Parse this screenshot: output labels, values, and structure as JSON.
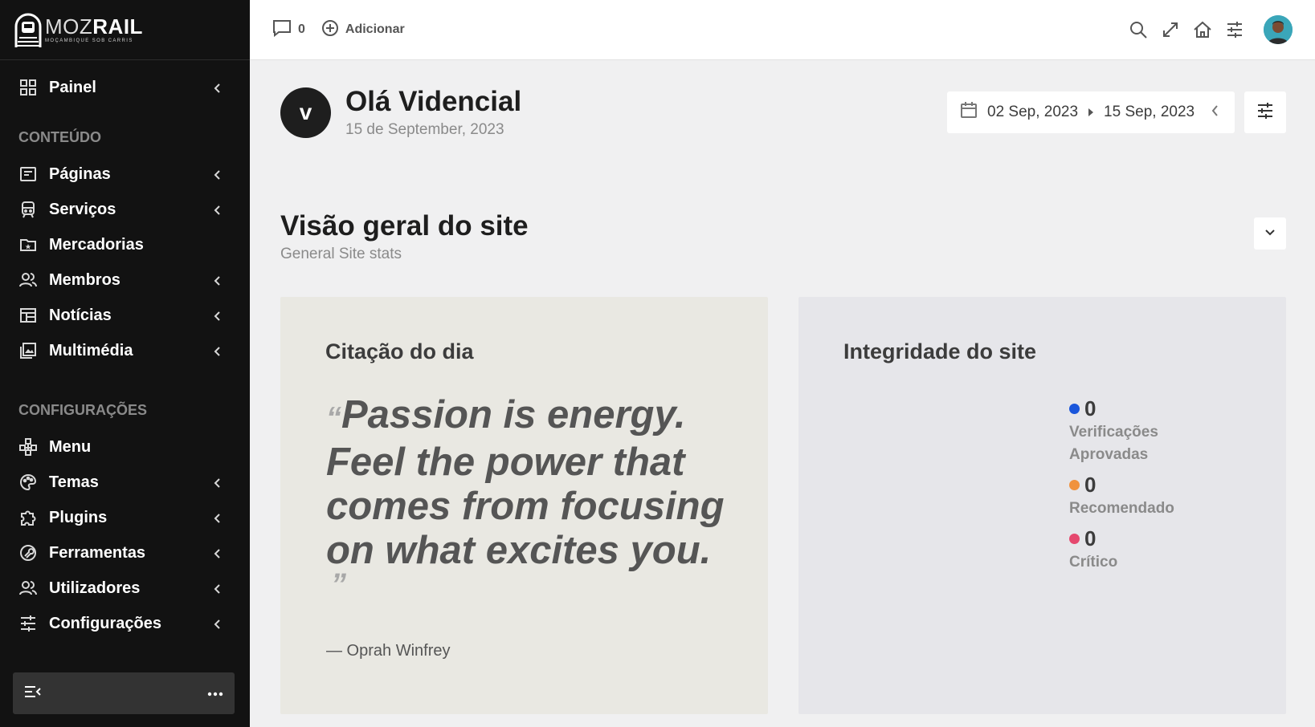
{
  "brand": {
    "word_thin": "MOZ",
    "word_bold": "RAIL",
    "tagline": "MOÇAMBIQUE SOB CARRIS"
  },
  "sidebar": {
    "top_items": [
      {
        "label": "Painel",
        "icon": "grid-icon",
        "has_submenu": true
      }
    ],
    "section_content": "CONTEÚDO",
    "content_items": [
      {
        "label": "Páginas",
        "icon": "page-icon",
        "has_submenu": true
      },
      {
        "label": "Serviços",
        "icon": "train-icon",
        "has_submenu": true
      },
      {
        "label": "Mercadorias",
        "icon": "folder-star-icon",
        "has_submenu": false
      },
      {
        "label": "Membros",
        "icon": "people-icon",
        "has_submenu": true
      },
      {
        "label": "Notícias",
        "icon": "news-icon",
        "has_submenu": true
      },
      {
        "label": "Multimédia",
        "icon": "images-icon",
        "has_submenu": true
      }
    ],
    "section_settings": "CONFIGURAÇÕES",
    "settings_items": [
      {
        "label": "Menu",
        "icon": "menu-tree-icon",
        "has_submenu": false
      },
      {
        "label": "Temas",
        "icon": "palette-icon",
        "has_submenu": true
      },
      {
        "label": "Plugins",
        "icon": "puzzle-icon",
        "has_submenu": true
      },
      {
        "label": "Ferramentas",
        "icon": "tools-icon",
        "has_submenu": true
      },
      {
        "label": "Utilizadores",
        "icon": "users-icon",
        "has_submenu": true
      },
      {
        "label": "Configurações",
        "icon": "sliders-icon",
        "has_submenu": true
      }
    ]
  },
  "topbar": {
    "comments_count": "0",
    "add_label": "Adicionar"
  },
  "greeting": {
    "initial": "v",
    "title": "Olá Videncial",
    "date": "15 de September, 2023"
  },
  "daterange": {
    "start": "02 Sep, 2023",
    "end": "15 Sep, 2023"
  },
  "overview": {
    "title": "Visão geral do site",
    "subtitle": "General Site stats"
  },
  "quote_card": {
    "title": "Citação do dia",
    "open_mark": "“",
    "close_mark": "”",
    "text": "Passion is energy. Feel the power that comes from focusing on what excites you.",
    "author": "— Oprah Winfrey"
  },
  "health_card": {
    "title": "Integridade do site",
    "items": [
      {
        "value": "0",
        "label": "Verificações Aprovadas",
        "color": "#1a56db"
      },
      {
        "value": "0",
        "label": "Recomendado",
        "color": "#f0923d"
      },
      {
        "value": "0",
        "label": "Crítico",
        "color": "#e5486e"
      }
    ]
  }
}
